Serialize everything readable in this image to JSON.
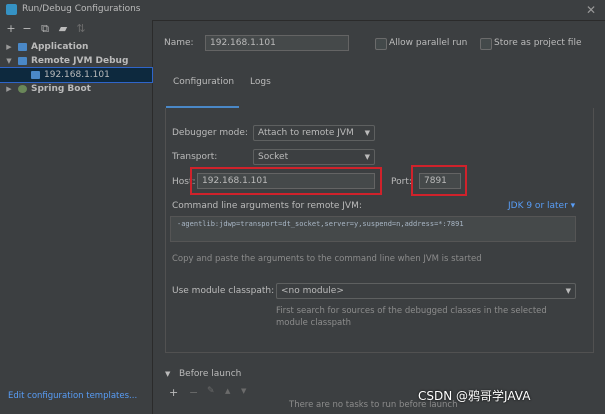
{
  "window": {
    "title": "Run/Debug Configurations",
    "close_glyph": "✕"
  },
  "toolbar": [
    "+",
    "−",
    "⧉",
    "▰",
    "⇅"
  ],
  "tree": [
    {
      "label": "Application",
      "arrow": "▶",
      "icon_color": "#4a88c7"
    },
    {
      "label": "Remote JVM Debug",
      "arrow": "▼",
      "icon_color": "#4a88c7"
    },
    {
      "label": "192.168.1.101",
      "icon_color": "#4a88c7"
    },
    {
      "label": "Spring Boot",
      "arrow": "▶",
      "icon_color": "#6a8759"
    }
  ],
  "left_footer": {
    "edit_templates": "Edit configuration templates..."
  },
  "form": {
    "name_label": "Name:",
    "name_value": "192.168.1.101",
    "allow_parallel": "Allow parallel run",
    "store_as_project": "Store as project file",
    "tabs": [
      "Configuration",
      "Logs"
    ],
    "debugger_mode_label": "Debugger mode:",
    "debugger_mode_value": "Attach to remote JVM",
    "transport_label": "Transport:",
    "transport_value": "Socket",
    "host_label": "Host:",
    "host_value": "192.168.1.101",
    "port_label": "Port:",
    "port_value": "7891",
    "cmdline_label": "Command line arguments for remote JVM:",
    "jdk_link": "JDK 9 or later ▾",
    "cmdline_value": "-agentlib:jdwp=transport=dt_socket,server=y,suspend=n,address=*:7891",
    "cmdline_hint": "Copy and paste the arguments to the command line when JVM is started",
    "module_label": "Use module classpath:",
    "module_value": "<no module>",
    "module_hint_1": "First search for sources of the debugged classes in the selected",
    "module_hint_2": "module classpath",
    "before_launch_label": "Before launch",
    "before_launch_arrow": "▼",
    "before_launch_tools": [
      "+",
      "−",
      "✎",
      "▲",
      "▼"
    ],
    "no_tasks": "There are no tasks to run before launch"
  },
  "watermark": "CSDN @鸦哥学JAVA",
  "colors": {
    "accent": "#4a88c7",
    "highlight_box": "#d0222b",
    "link": "#589df6"
  }
}
